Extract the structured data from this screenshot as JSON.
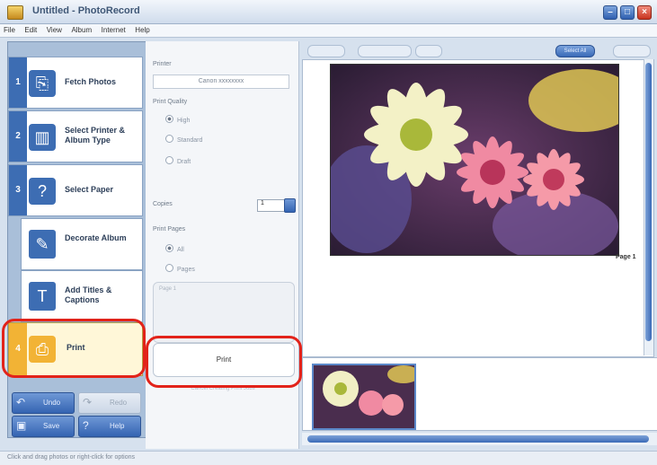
{
  "window": {
    "title": "Untitled - PhotoRecord"
  },
  "menu": [
    "File",
    "Edit",
    "View",
    "Album",
    "Internet",
    "Help"
  ],
  "steps": [
    {
      "num": "1",
      "label": "Fetch Photos"
    },
    {
      "num": "2",
      "label": "Select Printer & Album Type"
    },
    {
      "num": "3",
      "label": "Select Paper"
    },
    {
      "label": "Decorate Album"
    },
    {
      "label": "Add Titles & Captions"
    },
    {
      "num": "4",
      "label": "Print"
    }
  ],
  "bottom_buttons": {
    "undo": "Undo",
    "redo": "Redo",
    "save": "Save",
    "help": "Help"
  },
  "settings": {
    "printer_label": "Printer",
    "printer_value": "Canon xxxxxxxx",
    "quality_label": "Print Quality",
    "quality_options": [
      "High",
      "Standard",
      "Draft"
    ],
    "copies_label": "Copies",
    "copies_value": "1",
    "pages_label": "Print Pages",
    "pages_options": [
      "All",
      "Pages"
    ],
    "pages_field": "Page 1",
    "print_button": "Print",
    "cancel_button": "Cancel Creating Print Jobs"
  },
  "toolbar": {
    "select_all": "Select All"
  },
  "preview": {
    "page_label": "Page 1"
  },
  "status": {
    "text": "Click and drag photos or right-click for options"
  },
  "colors": {
    "accent": "#3d6db3",
    "active_step": "#f2b335",
    "highlight": "#e2231a"
  }
}
